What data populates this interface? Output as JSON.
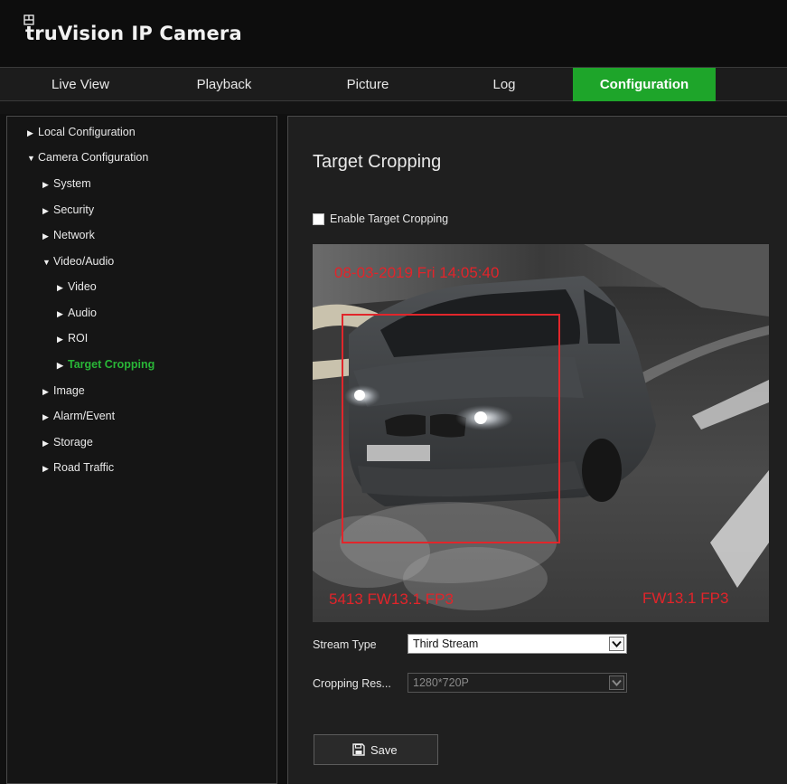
{
  "app": {
    "brand_prefix": "truVision",
    "brand_suffix": "IP Camera"
  },
  "nav": {
    "tabs": [
      {
        "label": "Live View"
      },
      {
        "label": "Playback"
      },
      {
        "label": "Picture"
      },
      {
        "label": "Log"
      },
      {
        "label": "Configuration",
        "active": true
      }
    ]
  },
  "sidebar": {
    "items": [
      {
        "label": "Local Configuration",
        "arrow": "▶"
      },
      {
        "label": "Camera Configuration",
        "arrow": "▼"
      },
      {
        "label": "System",
        "arrow": "▶"
      },
      {
        "label": "Security",
        "arrow": "▶"
      },
      {
        "label": "Network",
        "arrow": "▶"
      },
      {
        "label": "Video/Audio",
        "arrow": "▼"
      },
      {
        "label": "Video",
        "arrow": "▶"
      },
      {
        "label": "Audio",
        "arrow": "▶"
      },
      {
        "label": "ROI",
        "arrow": "▶"
      },
      {
        "label": "Target Cropping",
        "arrow": "▶",
        "selected": true
      },
      {
        "label": "Image",
        "arrow": "▶"
      },
      {
        "label": "Alarm/Event",
        "arrow": "▶"
      },
      {
        "label": "Storage",
        "arrow": "▶"
      },
      {
        "label": "Road Traffic",
        "arrow": "▶"
      }
    ]
  },
  "main": {
    "title": "Target Cropping",
    "enable_label": "Enable Target Cropping",
    "enable_checked": false,
    "osd": {
      "timestamp": "08-03-2019 Fri 14:05:40",
      "bottom_left": "5413 FW13.1 FP3",
      "bottom_right": "FW13.1 FP3"
    },
    "stream_type_label": "Stream Type",
    "stream_type_value": "Third Stream",
    "cropping_res_label": "Cropping Res...",
    "cropping_res_value": "1280*720P",
    "save_label": "Save"
  },
  "colors": {
    "accent": "#1ea52a",
    "osd_red": "#e2242a"
  }
}
